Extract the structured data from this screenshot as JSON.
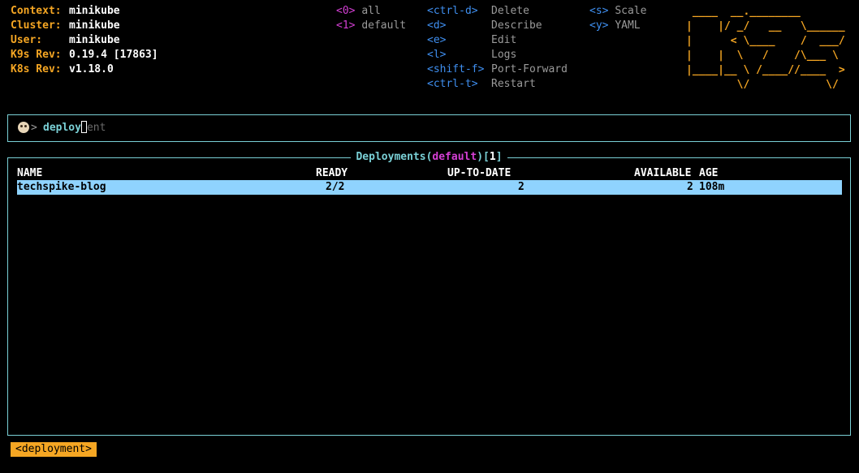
{
  "header": {
    "info": [
      {
        "key": "Context:",
        "value": "minikube"
      },
      {
        "key": "Cluster:",
        "value": "minikube"
      },
      {
        "key": "User:",
        "value": "minikube"
      },
      {
        "key": "K9s Rev:",
        "value": "0.19.4 [17863]"
      },
      {
        "key": "K8s Rev:",
        "value": "v1.18.0"
      }
    ],
    "namespaces": [
      {
        "key": "<0>",
        "label": "all"
      },
      {
        "key": "<1>",
        "label": "default"
      }
    ],
    "commands": [
      {
        "key": "<ctrl-d>",
        "label": "Delete"
      },
      {
        "key": "<d>",
        "label": "Describe"
      },
      {
        "key": "<e>",
        "label": "Edit"
      },
      {
        "key": "<l>",
        "label": "Logs"
      },
      {
        "key": "<shift-f>",
        "label": "Port-Forward"
      },
      {
        "key": "<ctrl-t>",
        "label": "Restart"
      }
    ],
    "commands2": [
      {
        "key": "<s>",
        "label": "Scale"
      },
      {
        "key": "<y>",
        "label": "YAML"
      }
    ],
    "logo": " ____  __.________\n|    |/ _/   __   \\______\n|      < \\____    /  ___/\n|    |  \\   /    /\\___ \\\n|____|__ \\ /____//____  >\n        \\/            \\/"
  },
  "prompt": {
    "caret": ">",
    "typed": "deploy",
    "suggestion": "ent"
  },
  "table": {
    "title_resource": "Deployments",
    "title_namespace": "default",
    "title_count": "1",
    "columns": [
      "NAME",
      "READY",
      "UP-TO-DATE",
      "AVAILABLE",
      "AGE"
    ],
    "rows": [
      {
        "name": "techspike-blog",
        "ready": "2/2",
        "uptodate": "2",
        "available": "2",
        "age": "108m"
      }
    ]
  },
  "breadcrumb": "<deployment>",
  "colors": {
    "accent_orange": "#f5a623",
    "border_cyan": "#7ad0d6",
    "namespace_magenta": "#d43fd4",
    "hotkey_blue": "#3f8ff0",
    "row_highlight": "#8fd3fe"
  }
}
